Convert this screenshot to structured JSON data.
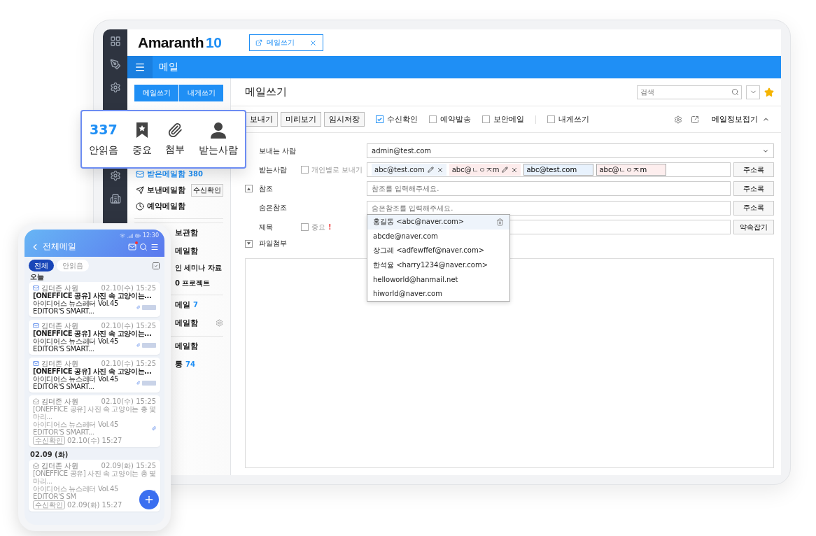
{
  "app": {
    "logo": "Amaranth",
    "version": "10",
    "open_tab": "메일쓰기",
    "module": "메일"
  },
  "sidebar": {
    "buttons": [
      "메일쓰기",
      "내게쓰기"
    ],
    "folders": [
      {
        "label": "받은메일함",
        "count": "380",
        "selected": true
      },
      {
        "label": "보낸메일함",
        "action": "수신확인",
        "selected": false
      },
      {
        "label": "예약메일함",
        "selected": false
      }
    ],
    "partial_items": [
      {
        "label": "보관함",
        "kind": "folder",
        "divider_before": true
      },
      {
        "label": "메일함",
        "kind": "folder",
        "divider_before": false
      },
      {
        "label": "인 세미나 자료",
        "kind": "sub",
        "divider_before": false
      },
      {
        "label": "0 프로젝트",
        "kind": "sub",
        "divider_before": false
      },
      {
        "label": "메일",
        "count": "7",
        "kind": "folder",
        "divider_before": true
      },
      {
        "label": "메일함",
        "kind": "setting",
        "divider_before": false
      },
      {
        "label": "메일함",
        "kind": "folder",
        "divider_before": true
      },
      {
        "label": "통",
        "count": "74",
        "kind": "folder",
        "divider_before": false
      }
    ]
  },
  "summary_popup": [
    {
      "kind": "count",
      "value": "337",
      "label": "안읽음"
    },
    {
      "kind": "star",
      "label": "중요"
    },
    {
      "kind": "clip",
      "label": "첨부"
    },
    {
      "kind": "person",
      "label": "받는사람"
    }
  ],
  "compose": {
    "title": "메일쓰기",
    "search": {
      "placeholder": "검색"
    },
    "starred": true,
    "toolbar_buttons": [
      "보내기",
      "미리보기",
      "임시저장"
    ],
    "options": [
      {
        "label": "수신확인",
        "checked": true
      },
      {
        "label": "예약발송",
        "checked": false
      },
      {
        "label": "보안메일",
        "checked": false
      },
      {
        "label": "내게쓰기",
        "checked": false
      }
    ],
    "info_toggle": {
      "label": "메일정보접기",
      "expanded": true
    },
    "from": {
      "label": "보내는 사람",
      "value": "admin@test.com"
    },
    "to": {
      "label": "받는사람",
      "individual": {
        "label": "개인별로 보내기",
        "checked": false
      },
      "chips": [
        {
          "text": "abc@test.com",
          "valid": true
        },
        {
          "text": "abc@ㄴㅇㅈm",
          "valid": false
        }
      ],
      "inputs": [
        {
          "value": "abc@test.com",
          "valid": true
        },
        {
          "value": "abc@ㄴㅇㅈm",
          "valid": false
        }
      ],
      "button": "주소록"
    },
    "cc": {
      "label": "참조",
      "expanded": true,
      "placeholder": "참조를 입력해주세요.",
      "button": "주소록"
    },
    "bcc": {
      "label": "숨은참조",
      "placeholder": "숨은참조를 입력해주세요.",
      "button": "주소록",
      "suggestions": [
        {
          "text": "홍길동 <abc@naver.com>",
          "selected": true
        },
        {
          "text": "abcde@naver.com",
          "selected": false
        },
        {
          "text": "장그레 <adfewffef@naver.com>",
          "selected": false
        },
        {
          "text": "한석율 <harry1234@naver.com>",
          "selected": false
        },
        {
          "text": "helloworld@hanmail.net",
          "selected": false
        },
        {
          "text": "hiworld@naver.com",
          "selected": false
        }
      ]
    },
    "subject": {
      "label": "제목",
      "important": {
        "label": "중요",
        "checked": false
      },
      "mark": "!",
      "button": "약속잡기"
    },
    "attach": {
      "label": "파일첨부",
      "expanded": false
    }
  },
  "phone": {
    "time": "12:30",
    "title": "전체메일",
    "has_new": true,
    "tabs": [
      {
        "label": "전체",
        "selected": true
      },
      {
        "label": "안읽음",
        "selected": false
      }
    ],
    "groups": [
      {
        "date": "오늘",
        "mails": [
          {
            "sender": "김더존 사원",
            "time": "02.10(수) 15:25",
            "subject": "[ONEFFICE 공유] 사진 속 고양이는...",
            "preview": "아이디어스 뉴스레터 Vol.45 EDITOR'S SMART...",
            "read": false,
            "tagged": true
          },
          {
            "sender": "김더존 사원",
            "time": "02.10(수) 15:25",
            "subject": "[ONEFFICE 공유] 사진 속 고양이는...",
            "preview": "아이디어스 뉴스레터 Vol.45 EDITOR'S SMART...",
            "read": false,
            "tagged": true
          },
          {
            "sender": "김더존 사원",
            "time": "02.10(수) 15:25",
            "subject": "[ONEFFICE 공유] 사진 속 고양이는...",
            "preview": "아이디어스 뉴스레터 Vol.45 EDITOR'S SMART...",
            "read": false,
            "tagged": true
          },
          {
            "sender": "김더존 사원",
            "time": "02.10(수) 15:25",
            "subject": "[ONEFFICE 공유] 사진 속 고양이는 총 몇 마리...",
            "preview": "아이디어스 뉴스레터 Vol.45 EDITOR'S SMART...",
            "read": true,
            "tagged": false,
            "receipt": {
              "badge": "수신확인",
              "time": "02.10(수) 15:27"
            }
          }
        ]
      },
      {
        "date": "02.09 (화)",
        "mails": [
          {
            "sender": "김더존 사원",
            "time": "02.09(화) 15:25",
            "subject": "[ONEFFICE 공유] 사진 속 고양이는 총 몇 마리...",
            "preview": "아이디어스 뉴스레터 Vol.45 EDITOR'S SM",
            "read": true,
            "tagged": false,
            "receipt": {
              "badge": "수신확인",
              "time": "02.09(화) 15:27"
            }
          }
        ]
      }
    ]
  }
}
